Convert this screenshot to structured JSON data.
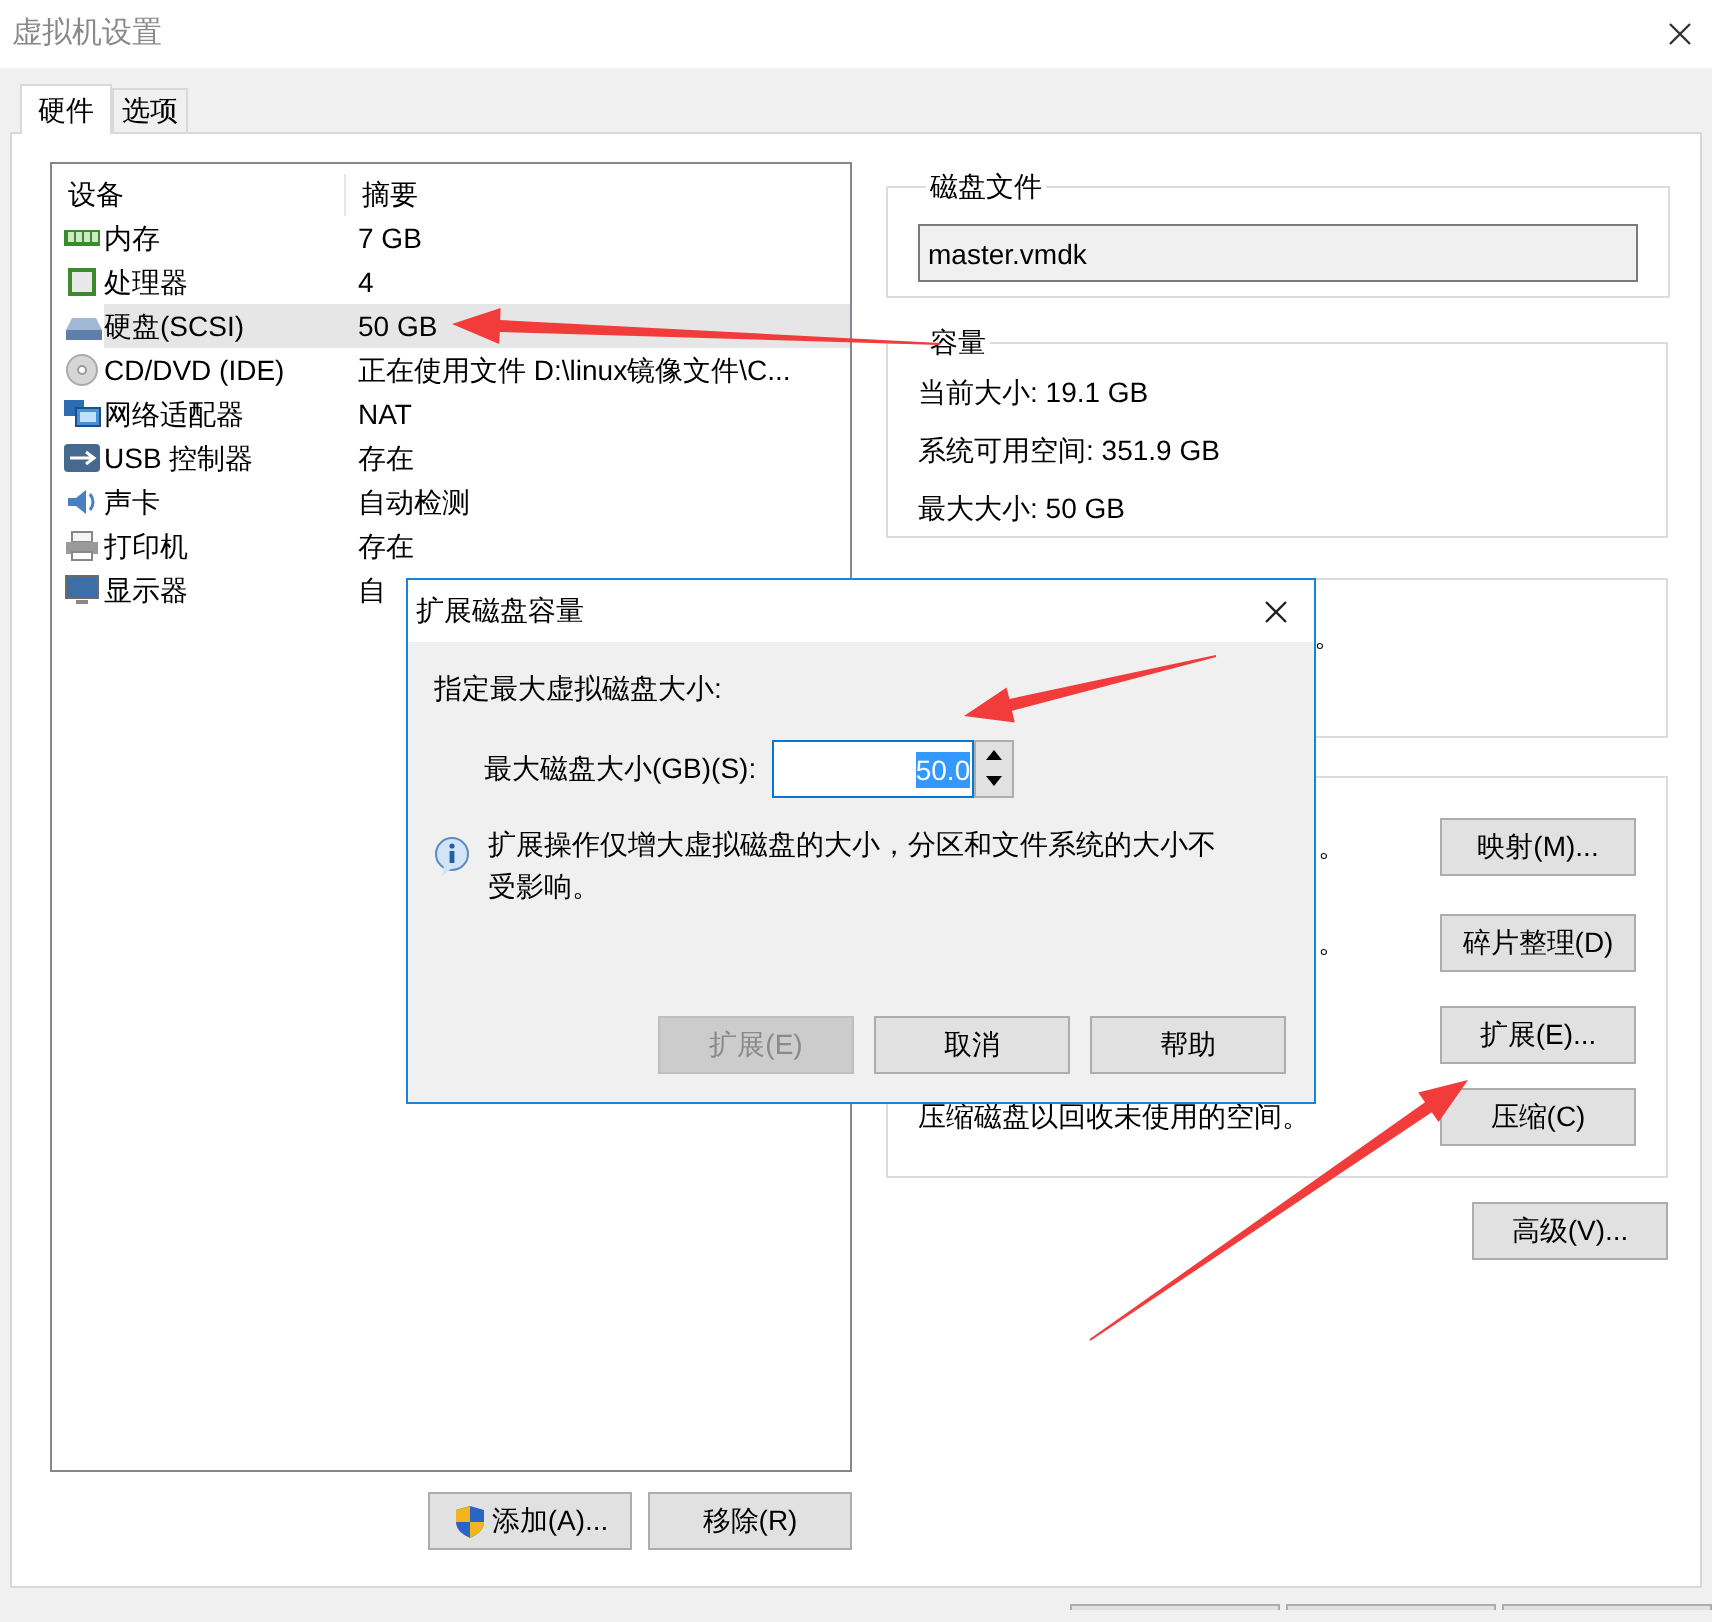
{
  "window": {
    "title": "虚拟机设置"
  },
  "tabs": [
    {
      "label": "硬件",
      "selected": true
    },
    {
      "label": "选项",
      "selected": false
    }
  ],
  "devices": {
    "columns": [
      "设备",
      "摘要"
    ],
    "rows": [
      {
        "kind": "memory",
        "name": "内存",
        "summary": "7 GB",
        "selected": false
      },
      {
        "kind": "cpu",
        "name": "处理器",
        "summary": "4",
        "selected": false
      },
      {
        "kind": "disk",
        "name": "硬盘(SCSI)",
        "summary": "50 GB",
        "selected": true
      },
      {
        "kind": "cd",
        "name": "CD/DVD (IDE)",
        "summary": "正在使用文件 D:\\linux镜像文件\\C...",
        "selected": false
      },
      {
        "kind": "network",
        "name": "网络适配器",
        "summary": "NAT",
        "selected": false
      },
      {
        "kind": "usb",
        "name": "USB 控制器",
        "summary": "存在",
        "selected": false
      },
      {
        "kind": "sound",
        "name": "声卡",
        "summary": "自动检测",
        "selected": false
      },
      {
        "kind": "printer",
        "name": "打印机",
        "summary": "存在",
        "selected": false
      },
      {
        "kind": "display",
        "name": "显示器",
        "summary": "自",
        "selected": false
      }
    ]
  },
  "device_buttons": [
    {
      "label": "添加(A)...",
      "shield": true
    },
    {
      "label": "移除(R)",
      "shield": false
    }
  ],
  "disk_file": {
    "title": "磁盘文件",
    "value": "master.vmdk"
  },
  "capacity": {
    "title": "容量",
    "lines": [
      "当前大小: 19.1 GB",
      "系统可用空间: 351.9 GB",
      "最大大小: 50 GB"
    ]
  },
  "group_3": {
    "text": "。"
  },
  "utilities": [
    {
      "kind": "cut",
      "text": "。",
      "button": "映射(M)..."
    },
    {
      "kind": "cut",
      "text": "。",
      "button": "碎片整理(D)"
    },
    {
      "kind": "hidden",
      "button": "扩展(E)..."
    },
    {
      "kind": "full",
      "text": "压缩磁盘以回收未使用的空间。",
      "button": "压缩(C)"
    }
  ],
  "advanced_button": "高级(V)...",
  "bottom_buttons": [
    {
      "kind": "cut"
    },
    {
      "kind": "cut"
    },
    {
      "kind": "cut"
    }
  ],
  "dialog": {
    "title": "扩展磁盘容量",
    "prompt": "指定最大虚拟磁盘大小:",
    "field_label": "最大磁盘大小(GB)(S):",
    "value": "50.0",
    "value_selected": true,
    "info": "扩展操作仅增大虚拟磁盘的大小，分区和文件系统的大小不受影响。",
    "buttons": [
      {
        "label": "扩展(E)",
        "disabled": true
      },
      {
        "label": "取消",
        "disabled": false
      },
      {
        "label": "帮助",
        "disabled": false
      }
    ]
  },
  "annotation_arrows": [
    {
      "kind": "arrow"
    },
    {
      "kind": "arrow"
    },
    {
      "kind": "arrow"
    }
  ]
}
